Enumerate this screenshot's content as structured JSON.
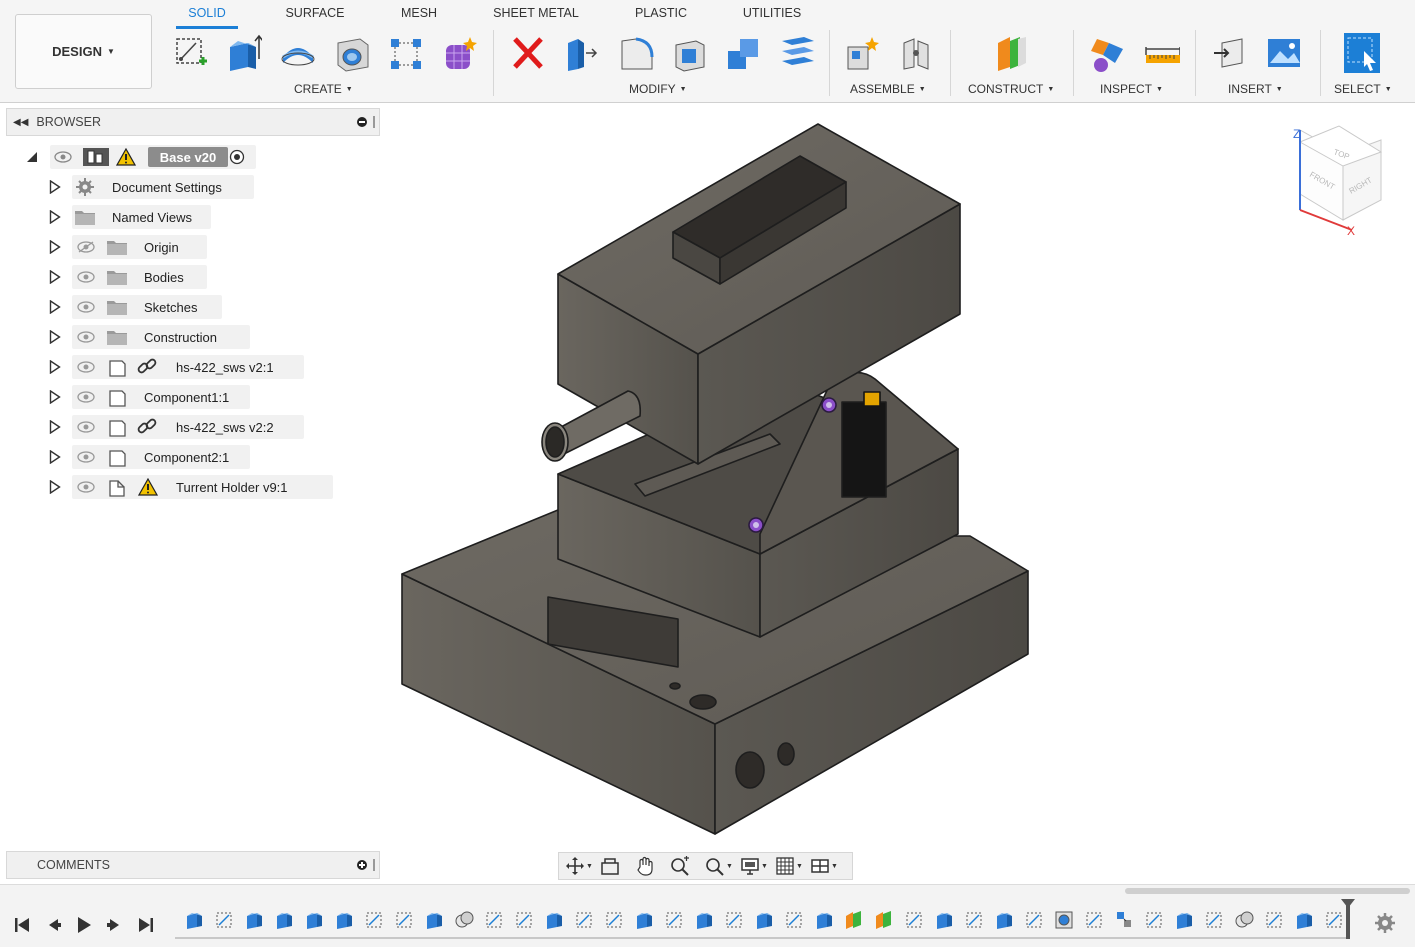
{
  "workspace": {
    "label": "DESIGN"
  },
  "tabs": [
    {
      "label": "SOLID",
      "active": true
    },
    {
      "label": "SURFACE",
      "active": false
    },
    {
      "label": "MESH",
      "active": false
    },
    {
      "label": "SHEET METAL",
      "active": false
    },
    {
      "label": "PLASTIC",
      "active": false
    },
    {
      "label": "UTILITIES",
      "active": false
    }
  ],
  "groups": {
    "create": "CREATE",
    "modify": "MODIFY",
    "assemble": "ASSEMBLE",
    "construct": "CONSTRUCT",
    "inspect": "INSPECT",
    "insert": "INSERT",
    "select": "SELECT"
  },
  "tools": {
    "create": [
      "create-sketch-icon",
      "extrude-icon",
      "revolve-icon",
      "hole-icon",
      "pattern-icon",
      "create-form-icon"
    ],
    "modify": [
      "delete-icon",
      "press-pull-icon",
      "fillet-icon",
      "shell-icon",
      "combine-icon",
      "offset-face-icon"
    ],
    "assemble": [
      "new-component-icon",
      "joint-icon"
    ],
    "construct": [
      "offset-plane-icon"
    ],
    "inspect": [
      "display-component-colors-icon",
      "measure-icon"
    ],
    "insert": [
      "insert-derive-icon",
      "insert-canvas-icon"
    ],
    "select": [
      "select-window-icon"
    ]
  },
  "browser": {
    "title": "BROWSER",
    "root": {
      "label": "Base v20",
      "warning": true
    },
    "items": [
      {
        "label": "Document Settings",
        "icon": "gear-icon",
        "eye": false
      },
      {
        "label": "Named Views",
        "icon": "folder-icon",
        "eye": false
      },
      {
        "label": "Origin",
        "icon": "folder-icon",
        "eye": "hidden"
      },
      {
        "label": "Bodies",
        "icon": "folder-icon",
        "eye": "visible"
      },
      {
        "label": "Sketches",
        "icon": "folder-icon",
        "eye": "visible"
      },
      {
        "label": "Construction",
        "icon": "folder-icon",
        "eye": "visible"
      },
      {
        "label": "hs-422_sws v2:1",
        "icon": "component-icon",
        "eye": "visible",
        "link": true
      },
      {
        "label": "Component1:1",
        "icon": "component-icon",
        "eye": "visible"
      },
      {
        "label": "hs-422_sws v2:2",
        "icon": "component-icon",
        "eye": "visible",
        "link": true
      },
      {
        "label": "Component2:1",
        "icon": "component-icon",
        "eye": "visible"
      },
      {
        "label": "Turrent Holder v9:1",
        "icon": "assembly-icon",
        "eye": "visible",
        "warning": true
      }
    ]
  },
  "comments": {
    "title": "COMMENTS"
  },
  "navbar": [
    "orbit-icon",
    "look-at-icon",
    "pan-icon",
    "zoom-icon",
    "fit-icon",
    "display-settings-icon",
    "grid-icon",
    "viewports-icon"
  ],
  "viewcube": {
    "top": "TOP",
    "front": "FRONT",
    "right": "RIGHT",
    "z": "Z",
    "x": "X"
  },
  "timeline": {
    "items": [
      "extrude",
      "sketch",
      "extrude",
      "extrude",
      "extrude",
      "extrude",
      "sketch",
      "sketch",
      "extrude",
      "combine",
      "sketch",
      "sketch",
      "extrude",
      "sketch",
      "sketch",
      "extrude",
      "sketch",
      "extrude",
      "sketch",
      "extrude",
      "sketch",
      "extrude",
      "plane",
      "plane",
      "sketch",
      "extrude",
      "sketch",
      "extrude",
      "sketch",
      "hole",
      "sketch",
      "joint",
      "sketch",
      "extrude",
      "sketch",
      "combine",
      "sketch",
      "extrude",
      "sketch"
    ]
  },
  "colors": {
    "accent": "#1c7fd6",
    "model": "#5a5650",
    "warning": "#f2c200"
  }
}
